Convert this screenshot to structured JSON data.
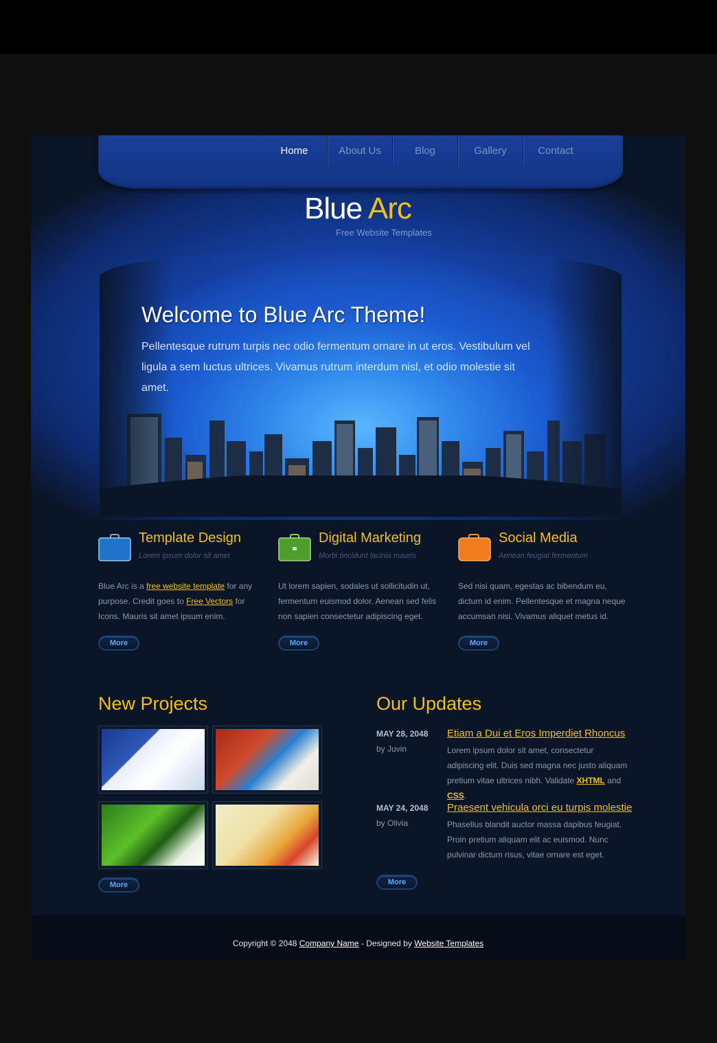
{
  "nav": {
    "items": [
      {
        "label": "Home",
        "active": true
      },
      {
        "label": "About Us",
        "active": false
      },
      {
        "label": "Blog",
        "active": false
      },
      {
        "label": "Gallery",
        "active": false
      },
      {
        "label": "Contact",
        "active": false
      }
    ]
  },
  "logo": {
    "part1": "Blue",
    "part2": "Arc",
    "tagline": "Free Website Templates"
  },
  "hero": {
    "title": "Welcome to Blue Arc Theme!",
    "text": "Pellentesque rutrum turpis nec odio fermentum ornare in ut eros. Vestibulum vel ligula a sem luctus ultrices. Vivamus rutrum interdum nisl, et odio molestie sit amet."
  },
  "features": [
    {
      "title": "Template Design",
      "subtitle": "Lorem ipsum dolor sit amet",
      "icon": "blue-briefcase-icon",
      "text_a": "Blue Arc is a ",
      "link_a": "free website template",
      "text_b": " for any purpose. Credit goes to ",
      "link_b": "Free Vectors",
      "text_c": " for Icons. Mauris sit amet ipsum enim.",
      "more": "More"
    },
    {
      "title": "Digital Marketing",
      "subtitle": "Morbi tincidunt lacinia mauris",
      "icon": "green-briefcase-icon",
      "text": "Ut lorem sapien, sodales ut sollicitudin ut, fermentum euismod dolor. Aenean sed felis non sapien consectetur adipiscing eget.",
      "more": "More"
    },
    {
      "title": "Social Media",
      "subtitle": "Aenean feugiat fermentum",
      "icon": "orange-briefcase-icon",
      "text": "Sed nisi quam, egestas ac bibendum eu, dictum id enim. Pellentesque et magna neque accumsan nisi. Vivamus aliquet metus id.",
      "more": "More"
    }
  ],
  "projects": {
    "title": "New Projects",
    "more": "More"
  },
  "updates": {
    "title": "Our Updates",
    "more": "More",
    "items": [
      {
        "date": "MAY 28, 2048",
        "by": "by Juvin",
        "title": "Etiam a Dui et Eros Imperdiet Rhoncus",
        "text": "Lorem ipsum dolor sit amet, consectetur adipiscing elit. Duis sed magna nec justo aliquam pretium vitae ultrices nibh. Validate ",
        "xhtml": "XHTML",
        "and": " and ",
        "css": "CSS",
        "end": "."
      },
      {
        "date": "MAY 24, 2048",
        "by": "by Olivia",
        "title": "Praesent vehicula orci eu turpis molestie",
        "text": "Phasellus blandit auctor massa dapibus feugiat. Proin pretium aliquam elit ac euismod. Nunc pulvinar dictum risus, vitae ornare est eget."
      }
    ]
  },
  "footer": {
    "copyright": "Copyright © 2048 ",
    "company": "Company Name",
    "designed": " - Designed by ",
    "designer": "Website Templates"
  },
  "colors": {
    "accent": "#f2c018",
    "link_blue": "#5aa9ff",
    "background": "#0b1528"
  }
}
